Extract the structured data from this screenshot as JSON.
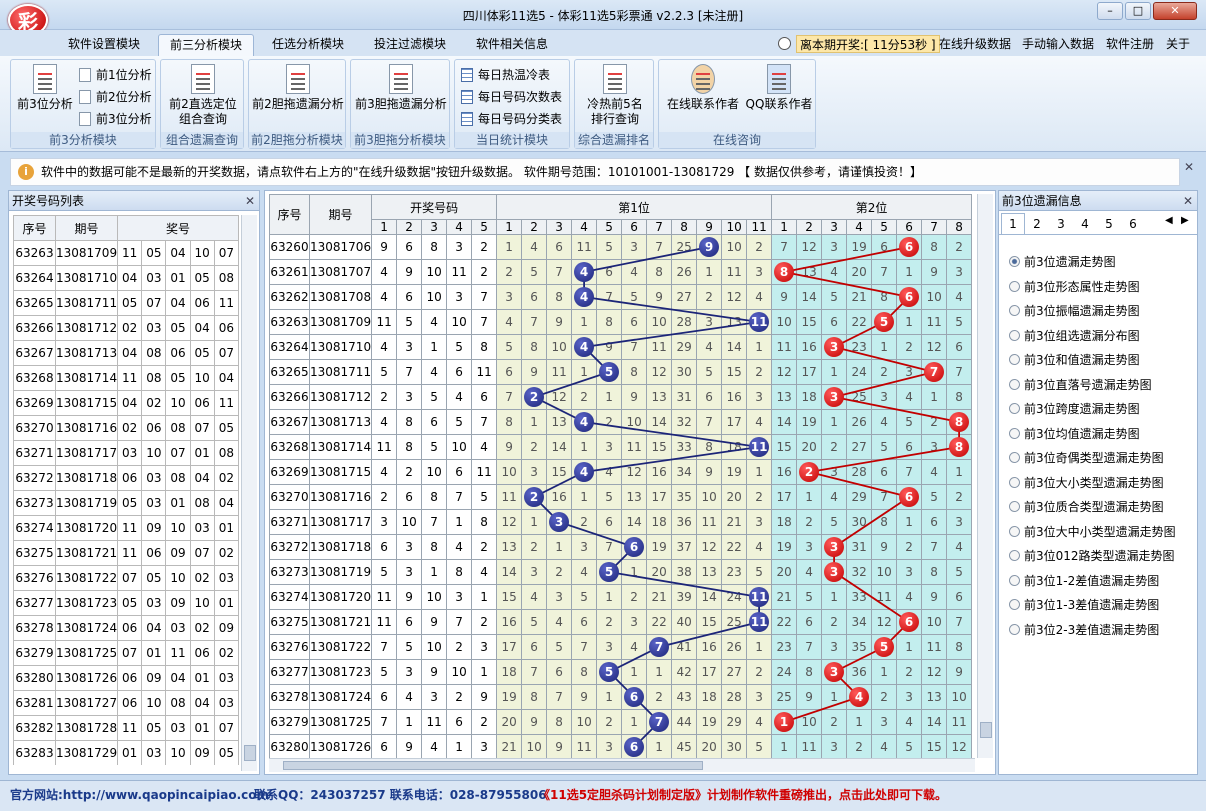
{
  "window": {
    "title": "四川体彩11选5 - 体彩11选5彩票通 v2.2.3 [未注册]",
    "logo": "彩"
  },
  "menu": {
    "tabs": [
      "软件设置模块",
      "前三分析模块",
      "任选分析模块",
      "投注过滤模块",
      "软件相关信息"
    ],
    "active_tab": 1,
    "countdown": "离本期开奖:[ 11分53秒 ]",
    "right": [
      "在线升级数据",
      "手动输入数据",
      "软件注册",
      "关于"
    ]
  },
  "ribbon": {
    "g1": {
      "caption": "前3分析模块",
      "big": "前3位分析",
      "items": [
        "前1位分析",
        "前2位分析",
        "前3位分析"
      ]
    },
    "g2": {
      "caption": "组合遗漏查询",
      "big1": "前2直选定位",
      "big2": "组合查询"
    },
    "g3": {
      "caption": "前2胆拖分析模块",
      "big": "前2胆拖遗漏分析"
    },
    "g4": {
      "caption": "前3胆拖分析模块",
      "big": "前3胆拖遗漏分析"
    },
    "g5": {
      "caption": "当日统计模块",
      "items": [
        "每日热温冷表",
        "每日号码次数表",
        "每日号码分类表"
      ]
    },
    "g6": {
      "caption": "综合遗漏排名",
      "big1": "冷热前5名",
      "big2": "排行查询"
    },
    "g7": {
      "caption": "在线咨询",
      "b1": "在线联系作者",
      "b2": "QQ联系作者"
    }
  },
  "info": {
    "icon": "i",
    "text": "软件中的数据可能不是最新的开奖数据，请点软件右上方的\"在线升级数据\"按钮升级数据。  软件期号范围：10101001-13081729 【 数据仅供参考，请谨慎投资！】"
  },
  "left_panel": {
    "title": "开奖号码列表",
    "headers": [
      "序号",
      "期号",
      "奖号"
    ],
    "rows": [
      [
        "63263",
        "13081709",
        "11",
        "05",
        "04",
        "10",
        "07"
      ],
      [
        "63264",
        "13081710",
        "04",
        "03",
        "01",
        "05",
        "08"
      ],
      [
        "63265",
        "13081711",
        "05",
        "07",
        "04",
        "06",
        "11"
      ],
      [
        "63266",
        "13081712",
        "02",
        "03",
        "05",
        "04",
        "06"
      ],
      [
        "63267",
        "13081713",
        "04",
        "08",
        "06",
        "05",
        "07"
      ],
      [
        "63268",
        "13081714",
        "11",
        "08",
        "05",
        "10",
        "04"
      ],
      [
        "63269",
        "13081715",
        "04",
        "02",
        "10",
        "06",
        "11"
      ],
      [
        "63270",
        "13081716",
        "02",
        "06",
        "08",
        "07",
        "05"
      ],
      [
        "63271",
        "13081717",
        "03",
        "10",
        "07",
        "01",
        "08"
      ],
      [
        "63272",
        "13081718",
        "06",
        "03",
        "08",
        "04",
        "02"
      ],
      [
        "63273",
        "13081719",
        "05",
        "03",
        "01",
        "08",
        "04"
      ],
      [
        "63274",
        "13081720",
        "11",
        "09",
        "10",
        "03",
        "01"
      ],
      [
        "63275",
        "13081721",
        "11",
        "06",
        "09",
        "07",
        "02"
      ],
      [
        "63276",
        "13081722",
        "07",
        "05",
        "10",
        "02",
        "03"
      ],
      [
        "63277",
        "13081723",
        "05",
        "03",
        "09",
        "10",
        "01"
      ],
      [
        "63278",
        "13081724",
        "06",
        "04",
        "03",
        "02",
        "09"
      ],
      [
        "63279",
        "13081725",
        "07",
        "01",
        "11",
        "06",
        "02"
      ],
      [
        "63280",
        "13081726",
        "06",
        "09",
        "04",
        "01",
        "03"
      ],
      [
        "63281",
        "13081727",
        "06",
        "10",
        "08",
        "04",
        "03"
      ],
      [
        "63282",
        "13081728",
        "11",
        "05",
        "03",
        "01",
        "07"
      ],
      [
        "63283",
        "13081729",
        "01",
        "03",
        "10",
        "09",
        "05"
      ]
    ]
  },
  "chart": {
    "h_seq": "序号",
    "h_issue": "期号",
    "h_draw": "开奖号码",
    "h_pos1": "第1位",
    "h_pos2": "第2位",
    "draw_cols": [
      "1",
      "2",
      "3",
      "4",
      "5"
    ],
    "pos1_cols": [
      "1",
      "2",
      "3",
      "4",
      "5",
      "6",
      "7",
      "8",
      "9",
      "10",
      "11"
    ],
    "pos2_cols": [
      "1",
      "2",
      "3",
      "4",
      "5",
      "6",
      "7",
      "8"
    ],
    "rows": [
      {
        "seq": "63260",
        "issue": "13081706",
        "d": [
          "9",
          "6",
          "8",
          "3",
          "2"
        ],
        "p1": [
          "1",
          "4",
          "6",
          "11",
          "5",
          "3",
          "7",
          "25",
          "9",
          "10",
          "2"
        ],
        "p2": [
          "7",
          "12",
          "3",
          "19",
          "6",
          "6",
          "8",
          "2"
        ]
      },
      {
        "seq": "63261",
        "issue": "13081707",
        "d": [
          "4",
          "9",
          "10",
          "11",
          "2"
        ],
        "p1": [
          "2",
          "5",
          "7",
          "4",
          "6",
          "4",
          "8",
          "26",
          "1",
          "11",
          "3"
        ],
        "p2": [
          "8",
          "13",
          "4",
          "20",
          "7",
          "1",
          "9",
          "3"
        ]
      },
      {
        "seq": "63262",
        "issue": "13081708",
        "d": [
          "4",
          "6",
          "10",
          "3",
          "7"
        ],
        "p1": [
          "3",
          "6",
          "8",
          "4",
          "7",
          "5",
          "9",
          "27",
          "2",
          "12",
          "4"
        ],
        "p2": [
          "9",
          "14",
          "5",
          "21",
          "8",
          "6",
          "10",
          "4"
        ]
      },
      {
        "seq": "63263",
        "issue": "13081709",
        "d": [
          "11",
          "5",
          "4",
          "10",
          "7"
        ],
        "p1": [
          "4",
          "7",
          "9",
          "1",
          "8",
          "6",
          "10",
          "28",
          "3",
          "13",
          "11"
        ],
        "p2": [
          "10",
          "15",
          "6",
          "22",
          "5",
          "1",
          "11",
          "5"
        ]
      },
      {
        "seq": "63264",
        "issue": "13081710",
        "d": [
          "4",
          "3",
          "1",
          "5",
          "8"
        ],
        "p1": [
          "5",
          "8",
          "10",
          "4",
          "9",
          "7",
          "11",
          "29",
          "4",
          "14",
          "1"
        ],
        "p2": [
          "11",
          "16",
          "3",
          "23",
          "1",
          "2",
          "12",
          "6"
        ]
      },
      {
        "seq": "63265",
        "issue": "13081711",
        "d": [
          "5",
          "7",
          "4",
          "6",
          "11"
        ],
        "p1": [
          "6",
          "9",
          "11",
          "1",
          "5",
          "8",
          "12",
          "30",
          "5",
          "15",
          "2"
        ],
        "p2": [
          "12",
          "17",
          "1",
          "24",
          "2",
          "3",
          "7",
          "7"
        ]
      },
      {
        "seq": "63266",
        "issue": "13081712",
        "d": [
          "2",
          "3",
          "5",
          "4",
          "6"
        ],
        "p1": [
          "7",
          "2",
          "12",
          "2",
          "1",
          "9",
          "13",
          "31",
          "6",
          "16",
          "3"
        ],
        "p2": [
          "13",
          "18",
          "3",
          "25",
          "3",
          "4",
          "1",
          "8"
        ]
      },
      {
        "seq": "63267",
        "issue": "13081713",
        "d": [
          "4",
          "8",
          "6",
          "5",
          "7"
        ],
        "p1": [
          "8",
          "1",
          "13",
          "4",
          "2",
          "10",
          "14",
          "32",
          "7",
          "17",
          "4"
        ],
        "p2": [
          "14",
          "19",
          "1",
          "26",
          "4",
          "5",
          "2",
          "8"
        ]
      },
      {
        "seq": "63268",
        "issue": "13081714",
        "d": [
          "11",
          "8",
          "5",
          "10",
          "4"
        ],
        "p1": [
          "9",
          "2",
          "14",
          "1",
          "3",
          "11",
          "15",
          "33",
          "8",
          "18",
          "11"
        ],
        "p2": [
          "15",
          "20",
          "2",
          "27",
          "5",
          "6",
          "3",
          "8"
        ]
      },
      {
        "seq": "63269",
        "issue": "13081715",
        "d": [
          "4",
          "2",
          "10",
          "6",
          "11"
        ],
        "p1": [
          "10",
          "3",
          "15",
          "4",
          "4",
          "12",
          "16",
          "34",
          "9",
          "19",
          "1"
        ],
        "p2": [
          "16",
          "2",
          "3",
          "28",
          "6",
          "7",
          "4",
          "1"
        ]
      },
      {
        "seq": "63270",
        "issue": "13081716",
        "d": [
          "2",
          "6",
          "8",
          "7",
          "5"
        ],
        "p1": [
          "11",
          "2",
          "16",
          "1",
          "5",
          "13",
          "17",
          "35",
          "10",
          "20",
          "2"
        ],
        "p2": [
          "17",
          "1",
          "4",
          "29",
          "7",
          "6",
          "5",
          "2"
        ]
      },
      {
        "seq": "63271",
        "issue": "13081717",
        "d": [
          "3",
          "10",
          "7",
          "1",
          "8"
        ],
        "p1": [
          "12",
          "1",
          "3",
          "2",
          "6",
          "14",
          "18",
          "36",
          "11",
          "21",
          "3"
        ],
        "p2": [
          "18",
          "2",
          "5",
          "30",
          "8",
          "1",
          "6",
          "3"
        ]
      },
      {
        "seq": "63272",
        "issue": "13081718",
        "d": [
          "6",
          "3",
          "8",
          "4",
          "2"
        ],
        "p1": [
          "13",
          "2",
          "1",
          "3",
          "7",
          "6",
          "19",
          "37",
          "12",
          "22",
          "4"
        ],
        "p2": [
          "19",
          "3",
          "3",
          "31",
          "9",
          "2",
          "7",
          "4"
        ]
      },
      {
        "seq": "63273",
        "issue": "13081719",
        "d": [
          "5",
          "3",
          "1",
          "8",
          "4"
        ],
        "p1": [
          "14",
          "3",
          "2",
          "4",
          "5",
          "1",
          "20",
          "38",
          "13",
          "23",
          "5"
        ],
        "p2": [
          "20",
          "4",
          "3",
          "32",
          "10",
          "3",
          "8",
          "5"
        ]
      },
      {
        "seq": "63274",
        "issue": "13081720",
        "d": [
          "11",
          "9",
          "10",
          "3",
          "1"
        ],
        "p1": [
          "15",
          "4",
          "3",
          "5",
          "1",
          "2",
          "21",
          "39",
          "14",
          "24",
          "11"
        ],
        "p2": [
          "21",
          "5",
          "1",
          "33",
          "11",
          "4",
          "9",
          "6"
        ]
      },
      {
        "seq": "63275",
        "issue": "13081721",
        "d": [
          "11",
          "6",
          "9",
          "7",
          "2"
        ],
        "p1": [
          "16",
          "5",
          "4",
          "6",
          "2",
          "3",
          "22",
          "40",
          "15",
          "25",
          "11"
        ],
        "p2": [
          "22",
          "6",
          "2",
          "34",
          "12",
          "6",
          "10",
          "7"
        ]
      },
      {
        "seq": "63276",
        "issue": "13081722",
        "d": [
          "7",
          "5",
          "10",
          "2",
          "3"
        ],
        "p1": [
          "17",
          "6",
          "5",
          "7",
          "3",
          "4",
          "7",
          "41",
          "16",
          "26",
          "1"
        ],
        "p2": [
          "23",
          "7",
          "3",
          "35",
          "5",
          "1",
          "11",
          "8"
        ]
      },
      {
        "seq": "63277",
        "issue": "13081723",
        "d": [
          "5",
          "3",
          "9",
          "10",
          "1"
        ],
        "p1": [
          "18",
          "7",
          "6",
          "8",
          "5",
          "1",
          "1",
          "42",
          "17",
          "27",
          "2"
        ],
        "p2": [
          "24",
          "8",
          "3",
          "36",
          "1",
          "2",
          "12",
          "9"
        ]
      },
      {
        "seq": "63278",
        "issue": "13081724",
        "d": [
          "6",
          "4",
          "3",
          "2",
          "9"
        ],
        "p1": [
          "19",
          "8",
          "7",
          "9",
          "1",
          "6",
          "2",
          "43",
          "18",
          "28",
          "3"
        ],
        "p2": [
          "25",
          "9",
          "1",
          "4",
          "2",
          "3",
          "13",
          "10"
        ]
      },
      {
        "seq": "63279",
        "issue": "13081725",
        "d": [
          "7",
          "1",
          "11",
          "6",
          "2"
        ],
        "p1": [
          "20",
          "9",
          "8",
          "10",
          "2",
          "1",
          "7",
          "44",
          "19",
          "29",
          "4"
        ],
        "p2": [
          "1",
          "10",
          "2",
          "1",
          "3",
          "4",
          "14",
          "11"
        ]
      },
      {
        "seq": "63280",
        "issue": "13081726",
        "d": [
          "6",
          "9",
          "4",
          "1",
          "3"
        ],
        "p1": [
          "21",
          "10",
          "9",
          "11",
          "3",
          "6",
          "1",
          "45",
          "20",
          "30",
          "5"
        ],
        "p2": [
          "1",
          "11",
          "3",
          "2",
          "4",
          "5",
          "15",
          "12"
        ]
      }
    ],
    "blue_line": [
      9,
      4,
      4,
      11,
      4,
      5,
      2,
      4,
      11,
      4,
      2,
      3,
      6,
      5,
      11,
      11,
      7,
      5,
      6,
      7,
      6
    ],
    "red_line": [
      6,
      1,
      6,
      5,
      3,
      7,
      3,
      8,
      8,
      2,
      6,
      0,
      3,
      3,
      0,
      6,
      5,
      3,
      4,
      1,
      0
    ]
  },
  "right_panel": {
    "title": "前3位遗漏信息",
    "tabs": [
      "1",
      "2",
      "3",
      "4",
      "5",
      "6"
    ],
    "active": 0,
    "options": [
      "前3位遗漏走势图",
      "前3位形态属性走势图",
      "前3位振幅遗漏走势图",
      "前3位组选遗漏分布图",
      "前3位和值遗漏走势图",
      "前3位直落号遗漏走势图",
      "前3位跨度遗漏走势图",
      "前3位均值遗漏走势图",
      "前3位奇偶类型遗漏走势图",
      "前3位大小类型遗漏走势图",
      "前3位质合类型遗漏走势图",
      "前3位大中小类型遗漏走势图",
      "前3位012路类型遗漏走势图",
      "前3位1-2差值遗漏走势图",
      "前3位1-3差值遗漏走势图",
      "前3位2-3差值遗漏走势图"
    ],
    "selected": 0
  },
  "status": {
    "site": "官方网站:http://www.qaopincaipiao.com",
    "contact": "联系QQ：243037257 联系电话：028-87955806",
    "promo": "《11选5定胆杀码计划制定版》计划制作软件重磅推出，点击此处即可下载。"
  },
  "colors": {
    "ribbon_bg": "#dce8f5",
    "ball_blue": "#1c2578",
    "ball_red": "#c20000",
    "zone1": "#f0f3da",
    "zone2": "#c3eeee"
  }
}
